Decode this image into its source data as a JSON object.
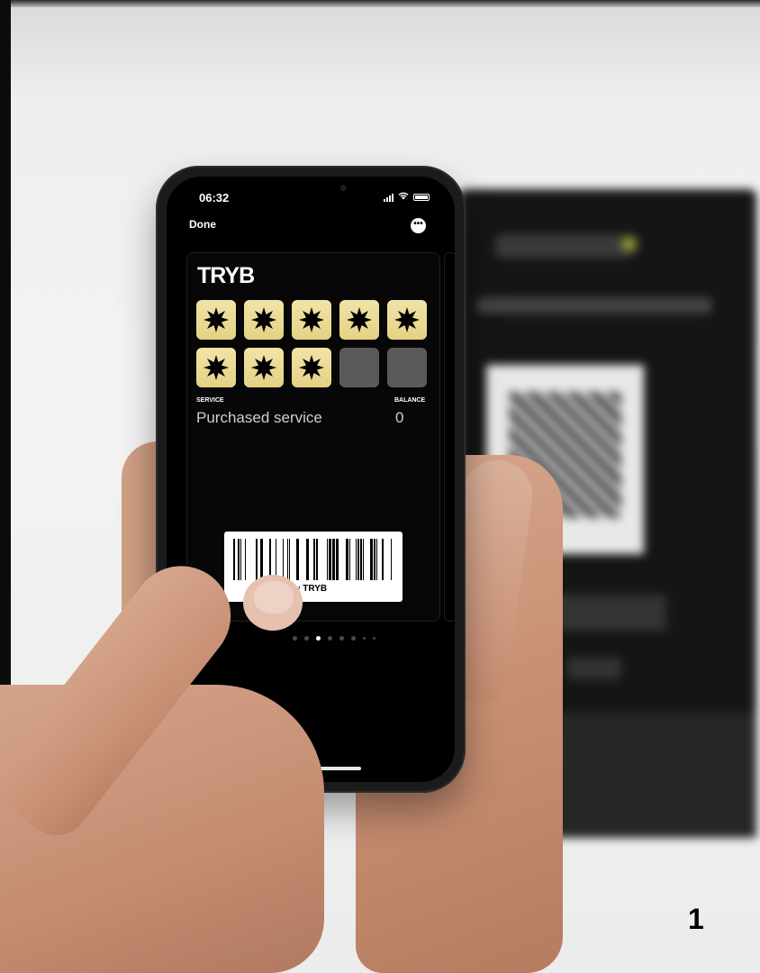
{
  "status_bar": {
    "time": "06:32"
  },
  "nav": {
    "done_label": "Done",
    "more_icon": "ellipsis-icon"
  },
  "pass": {
    "brand": "TRYB",
    "stamps_total": 10,
    "stamps_filled": 8,
    "stamp_icon": "star-burst-icon",
    "stamp_color": "#e9d991",
    "empty_color": "#5a5a5a",
    "service": {
      "label": "SERVICE",
      "value": "Purchased service"
    },
    "balance": {
      "label": "BALANCE",
      "value": "0"
    },
    "barcode": {
      "footer_prefix": "ed by",
      "footer_brand": "TRYB"
    }
  },
  "pager": {
    "total": 8,
    "active_index": 2
  },
  "page_number": "1"
}
